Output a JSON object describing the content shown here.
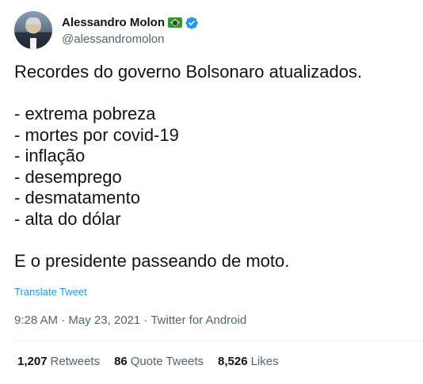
{
  "author": {
    "display_name": "Alessandro Molon",
    "handle": "@alessandromolon"
  },
  "tweet": {
    "lines": [
      "Recordes do governo Bolsonaro atualizados.",
      "",
      "- extrema pobreza",
      "- mortes por covid-19",
      "- inflação",
      "- desemprego",
      "- desmatamento",
      "- alta do dólar",
      "",
      "E o presidente passeando de moto."
    ],
    "translate_label": "Translate Tweet",
    "timestamp": "9:28 AM · May 23, 2021 · Twitter for Android"
  },
  "stats": [
    {
      "count": "1,207",
      "label": "Retweets"
    },
    {
      "count": "86",
      "label": "Quote Tweets"
    },
    {
      "count": "8,526",
      "label": "Likes"
    }
  ],
  "icons": {
    "flag": "brazil-flag-icon",
    "verified": "verified-badge-icon"
  },
  "colors": {
    "link_blue": "#1d9bf0",
    "secondary_text": "#536471",
    "primary_text": "#0f1419"
  }
}
